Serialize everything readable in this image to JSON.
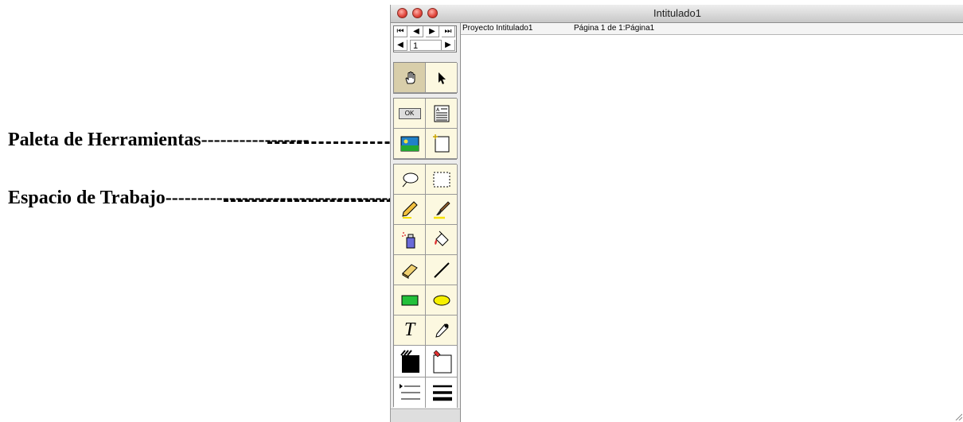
{
  "annotations": {
    "tool_palette": "Paleta de Herramientas-----------------",
    "workspace": "Espacio de Trabajo------------------------------------"
  },
  "window": {
    "title": "Intitulado1"
  },
  "navigator": {
    "first": "⏮",
    "prev": "◀",
    "next": "▶",
    "last": "⏭",
    "page_back": "◀",
    "page_forward": "▶",
    "page_number": "1"
  },
  "infobar": {
    "project": "Proyecto Intitulado1",
    "page": "Página 1 de 1:Página1"
  },
  "tools": [
    {
      "name": "hand-icon",
      "selected": true
    },
    {
      "name": "arrow-pointer-icon",
      "selected": false
    },
    {
      "name": "button-tool-icon",
      "label": "OK"
    },
    {
      "name": "field-tool-icon"
    },
    {
      "name": "graphic-tool-icon"
    },
    {
      "name": "new-page-icon"
    },
    {
      "name": "lasso-icon"
    },
    {
      "name": "marquee-select-icon"
    },
    {
      "name": "pencil-icon"
    },
    {
      "name": "brush-icon"
    },
    {
      "name": "spray-can-icon"
    },
    {
      "name": "paint-bucket-icon"
    },
    {
      "name": "eraser-icon"
    },
    {
      "name": "line-icon"
    },
    {
      "name": "rectangle-icon"
    },
    {
      "name": "oval-icon"
    },
    {
      "name": "text-tool-icon",
      "label": "T"
    },
    {
      "name": "eyedropper-icon"
    }
  ],
  "colors": {
    "window_bg": "#ffffff",
    "palette_cell": "#fcf8e0",
    "palette_selected": "#d8ceaa",
    "traffic_red": "#e0443a",
    "rect_green": "#22c03a",
    "oval_yellow": "#f6f000"
  }
}
